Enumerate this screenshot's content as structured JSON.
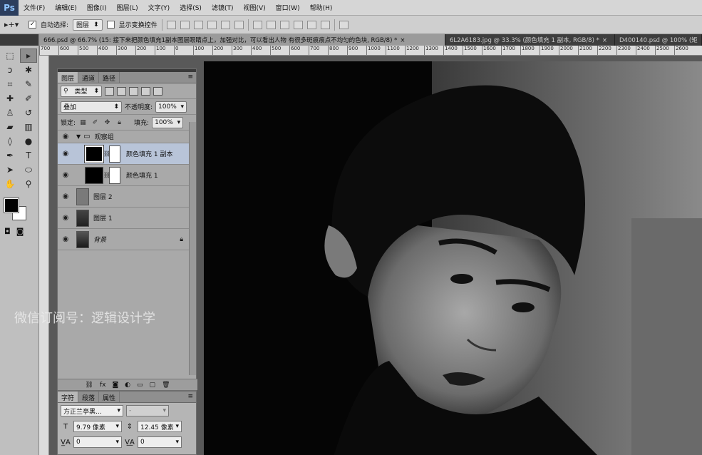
{
  "app": {
    "logo": "Ps"
  },
  "menu": [
    "文件(F)",
    "编辑(E)",
    "图像(I)",
    "图层(L)",
    "文字(Y)",
    "选择(S)",
    "滤镜(T)",
    "视图(V)",
    "窗口(W)",
    "帮助(H)"
  ],
  "options_bar": {
    "auto_select_label": "自动选择:",
    "auto_select_value": "图层",
    "show_transform_label": "显示变换控件"
  },
  "tabs": [
    {
      "label": "666.psd @ 66.7% (15: 接下来把颜色填充1副本图层眼睛点上，加强对比，可以看出人物 有很多斑痕痕点不均匀的色块, RGB/8) *",
      "close": "×",
      "active": true
    },
    {
      "label": "6L2A6183.jpg @ 33.3% (颜色填充 1 副本, RGB/8) *",
      "close": "×",
      "active": false
    },
    {
      "label": "D400140.psd @ 100% (矩",
      "close": "",
      "active": false
    }
  ],
  "ruler": [
    "700",
    "600",
    "500",
    "400",
    "300",
    "200",
    "100",
    "0",
    "100",
    "200",
    "300",
    "400",
    "500",
    "600",
    "700",
    "800",
    "900",
    "1000",
    "1100",
    "1200",
    "1300",
    "1400",
    "1500",
    "1600",
    "1700",
    "1800",
    "1900",
    "2000",
    "2100",
    "2200",
    "2300",
    "2400",
    "2500",
    "2600"
  ],
  "layers_panel": {
    "tabs": [
      "图层",
      "通道",
      "路径"
    ],
    "filter_label": "类型",
    "blend_mode": "叠加",
    "opacity_label": "不透明度:",
    "opacity_value": "100%",
    "lock_label": "锁定:",
    "fill_label": "填充:",
    "fill_value": "100%",
    "group_name": "观察组",
    "layers": [
      {
        "name": "颜色填充 1 副本",
        "selected": true,
        "thumb": "black",
        "has_mask": true
      },
      {
        "name": "颜色填充 1",
        "selected": false,
        "thumb": "black",
        "has_mask": true
      },
      {
        "name": "图层 2",
        "selected": false,
        "thumb": "gray",
        "has_mask": false
      },
      {
        "name": "图层 1",
        "selected": false,
        "thumb": "photo",
        "has_mask": false
      },
      {
        "name": "背景",
        "selected": false,
        "thumb": "photo",
        "has_mask": false,
        "locked": true
      }
    ]
  },
  "character_panel": {
    "tabs": [
      "字符",
      "段落",
      "属性"
    ],
    "font_family": "方正兰亭黑...",
    "font_style": "-",
    "font_size": "9.79 像素",
    "leading": "12.45 像素",
    "kerning": "0",
    "tracking": "0"
  },
  "canvas": {
    "watermark": "微信订阅号：逻辑设计学"
  },
  "colors": {
    "selected_layer": "#b8c4d8",
    "panel": "#a9a9a9",
    "foreground": "#000000",
    "background": "#ffffff"
  }
}
